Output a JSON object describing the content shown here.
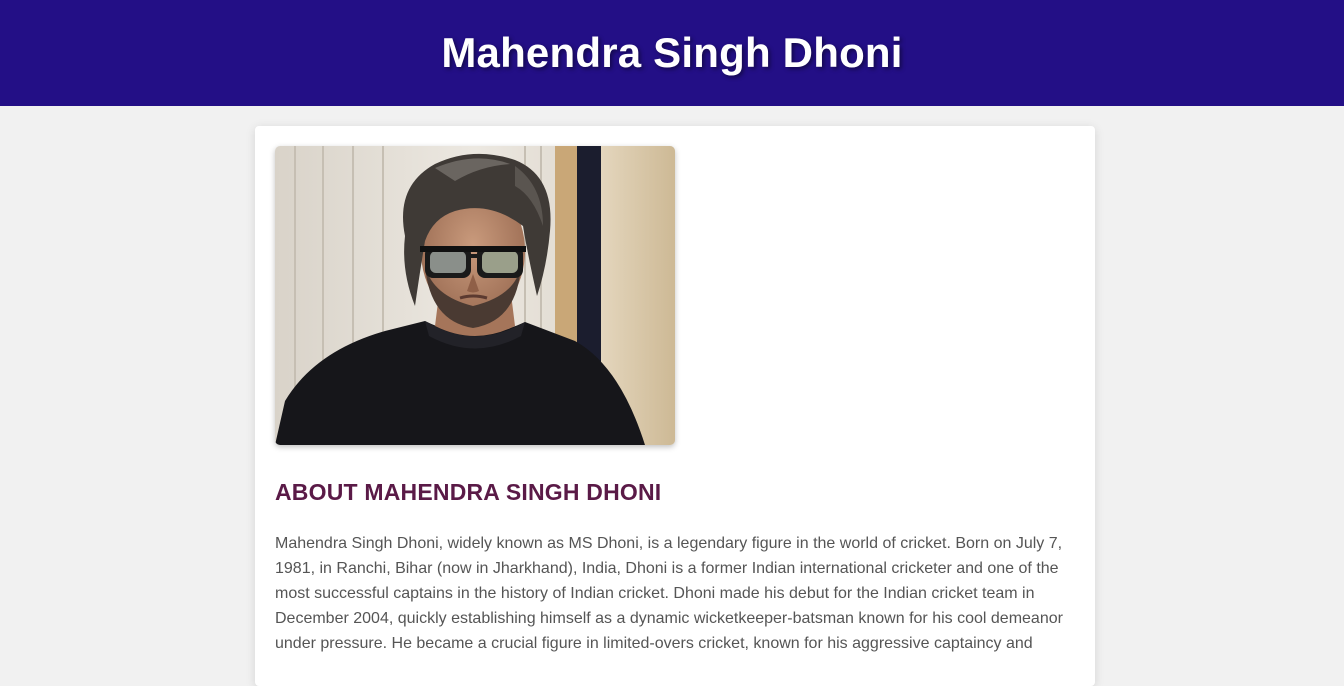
{
  "header": {
    "title": "Mahendra Singh Dhoni",
    "background_color": "#230f86"
  },
  "profile": {
    "image_description_icon": "portrait-photo",
    "section_heading": "ABOUT MAHENDRA SINGH DHONI",
    "heading_color": "#5a1a47",
    "bio": "Mahendra Singh Dhoni, widely known as MS Dhoni, is a legendary figure in the world of cricket. Born on July 7, 1981, in Ranchi, Bihar (now in Jharkhand), India, Dhoni is a former Indian international cricketer and one of the most successful captains in the history of Indian cricket. Dhoni made his debut for the Indian cricket team in December 2004, quickly establishing himself as a dynamic wicketkeeper-batsman known for his cool demeanor under pressure. He became a crucial figure in limited-overs cricket, known for his aggressive captaincy and"
  }
}
